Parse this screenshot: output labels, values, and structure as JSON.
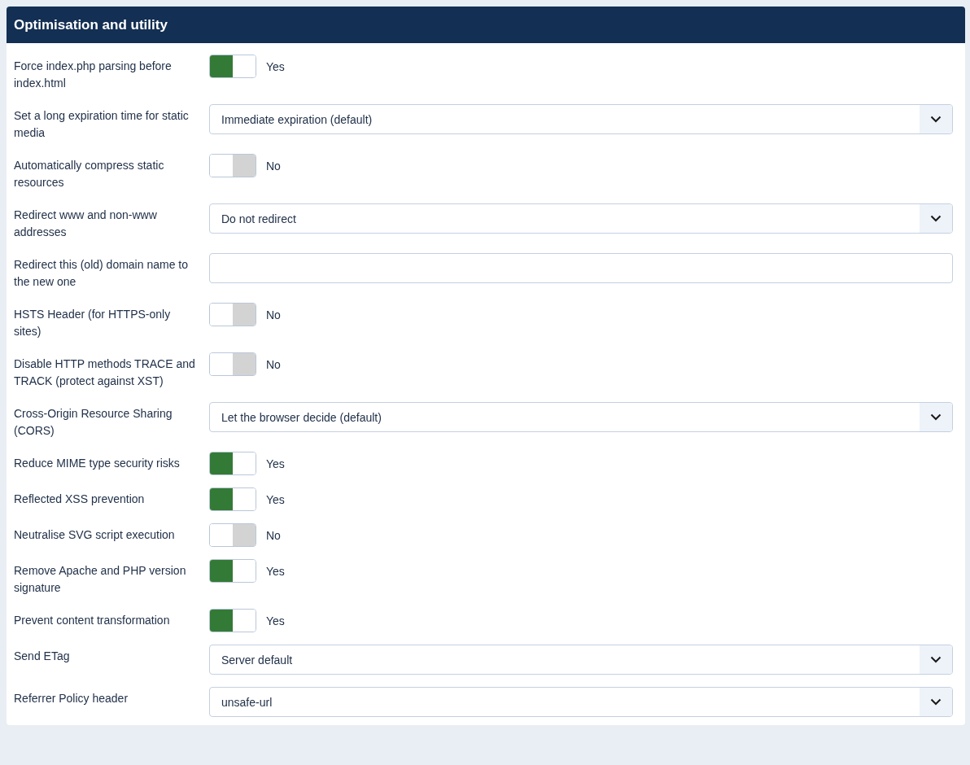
{
  "panel": {
    "title": "Optimisation and utility"
  },
  "rows": [
    {
      "kind": "toggle",
      "label": "Force index.php parsing before index.html",
      "on": true,
      "state_label": "Yes"
    },
    {
      "kind": "select",
      "label": "Set a long expiration time for static media",
      "value": "Immediate expiration (default)"
    },
    {
      "kind": "toggle",
      "label": "Automatically compress static resources",
      "on": false,
      "state_label": "No"
    },
    {
      "kind": "select",
      "label": "Redirect www and non-www addresses",
      "value": "Do not redirect"
    },
    {
      "kind": "text",
      "label": "Redirect this (old) domain name to the new one"
    },
    {
      "kind": "toggle",
      "label": "HSTS Header (for HTTPS-only sites)",
      "on": false,
      "state_label": "No"
    },
    {
      "kind": "toggle",
      "label": "Disable HTTP methods TRACE and TRACK (protect against XST)",
      "on": false,
      "state_label": "No"
    },
    {
      "kind": "select",
      "label": "Cross-Origin Resource Sharing (CORS)",
      "value": "Let the browser decide (default)"
    },
    {
      "kind": "toggle",
      "label": "Reduce MIME type security risks",
      "on": true,
      "state_label": "Yes"
    },
    {
      "kind": "toggle",
      "label": "Reflected XSS prevention",
      "on": true,
      "state_label": "Yes"
    },
    {
      "kind": "toggle",
      "label": "Neutralise SVG script execution",
      "on": false,
      "state_label": "No"
    },
    {
      "kind": "toggle",
      "label": "Remove Apache and PHP version signature",
      "on": true,
      "state_label": "Yes"
    },
    {
      "kind": "toggle",
      "label": "Prevent content transformation",
      "on": true,
      "state_label": "Yes"
    },
    {
      "kind": "select",
      "label": "Send ETag",
      "value": "Server default"
    },
    {
      "kind": "select",
      "label": "Referrer Policy header",
      "value": "unsafe-url"
    }
  ]
}
